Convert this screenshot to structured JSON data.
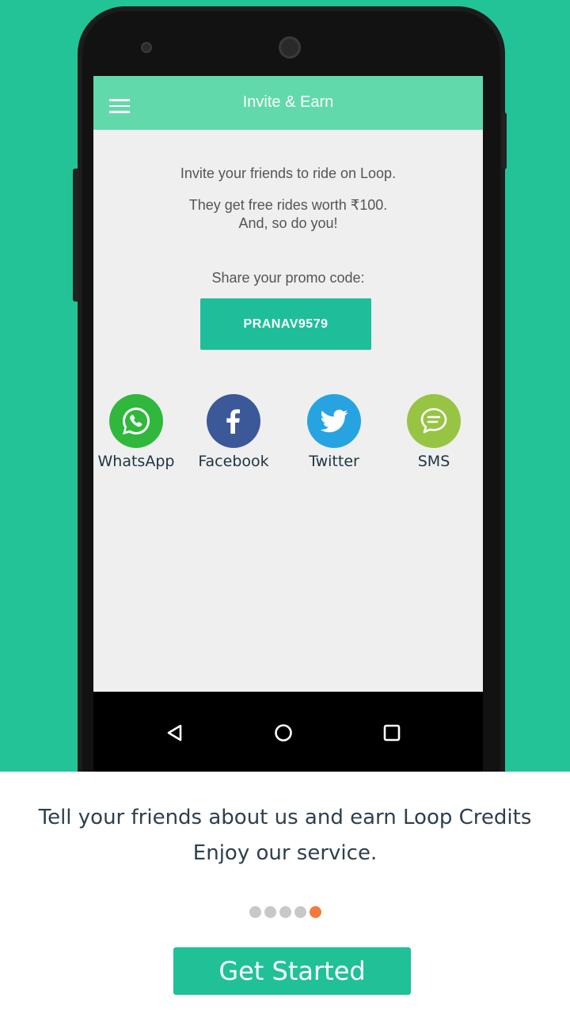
{
  "app_bar": {
    "title": "Invite & Earn",
    "menu_icon": "hamburger-menu-icon"
  },
  "content": {
    "invite_line": "Invite your friends to ride on Loop.",
    "reward_line_1": "They get free rides worth ₹100.",
    "reward_line_2": "And, so do you!",
    "share_prompt": "Share your promo code:",
    "promo_code": "PRANAV9579"
  },
  "share_options": [
    {
      "label": "WhatsApp",
      "icon": "whatsapp-icon",
      "color": "#2fb83c"
    },
    {
      "label": "Facebook",
      "icon": "facebook-icon",
      "color": "#3b5998"
    },
    {
      "label": "Twitter",
      "icon": "twitter-icon",
      "color": "#27a3e1"
    },
    {
      "label": "SMS",
      "icon": "sms-icon",
      "color": "#98c444"
    }
  ],
  "android_nav": {
    "icons": [
      "back-icon",
      "home-icon",
      "recents-icon"
    ]
  },
  "onboarding": {
    "caption_line_1": "Tell your friends about us and earn Loop Credits",
    "caption_line_2": "Enjoy our service.",
    "page_count": 5,
    "current_page": 5,
    "cta_label": "Get Started"
  },
  "colors": {
    "brand_green": "#22c497",
    "app_bar": "#62d9aa",
    "active_dot": "#f47a3c",
    "inactive_dot": "#c8c8c8"
  }
}
